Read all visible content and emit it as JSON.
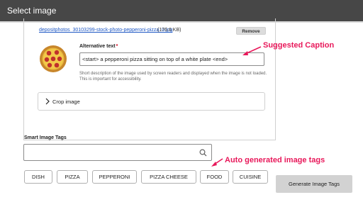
{
  "dialog": {
    "title": "Select image"
  },
  "file": {
    "link_text": "depositphotos_30103299-stock-photo-pepperoni-pizza_0.jpg",
    "size": "(176.6 KB)",
    "remove_label": "Remove"
  },
  "alt_text": {
    "label": "Alternative text",
    "required_mark": "*",
    "value": "<start> a pepperoni pizza sitting on top of a white plate <end>",
    "description": "Short description of the image used by screen readers and displayed when the image is not loaded. This is important for accessibility."
  },
  "crop": {
    "label": "Crop image"
  },
  "annotations": {
    "caption": "Suggested Caption",
    "tags": "Auto generated image tags"
  },
  "smart_tags": {
    "label": "Smart Image Tags",
    "input_value": "",
    "tags": [
      "DISH",
      "PIZZA",
      "PEPPERONI",
      "PIZZA CHEESE",
      "FOOD",
      "CUISINE"
    ],
    "generate_label": "Generate Image Tags"
  },
  "colors": {
    "titlebar": "#474747",
    "annotation": "#e8185a",
    "link": "#1f58c4",
    "button_gray": "#d2d2d2"
  },
  "icons": [
    "pizza-image",
    "chevron-right-icon",
    "search-icon",
    "arrow-icon"
  ]
}
